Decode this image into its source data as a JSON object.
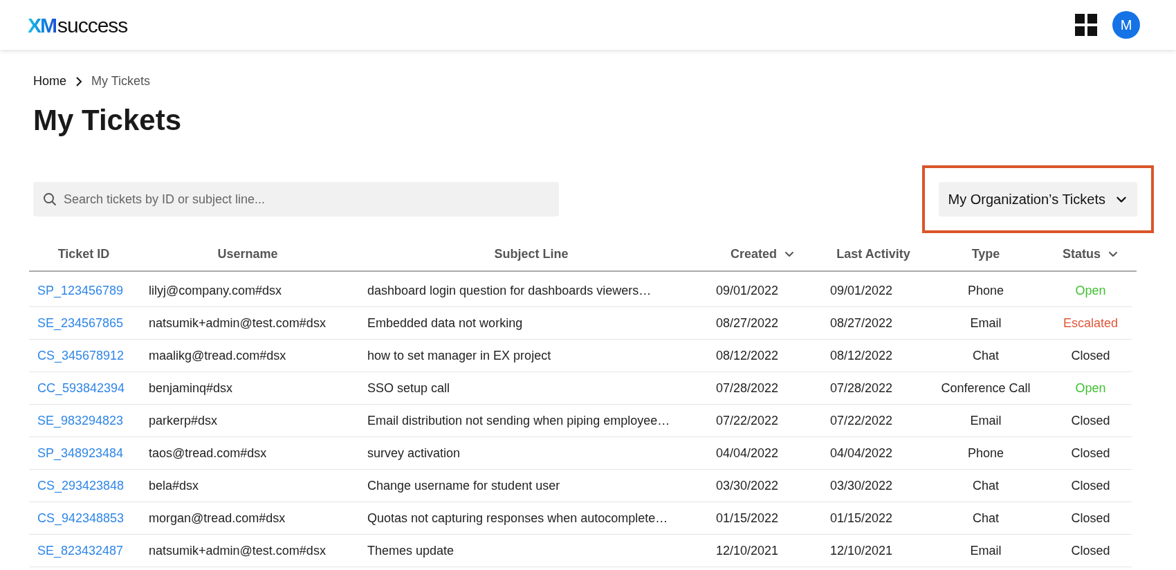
{
  "brand": {
    "mark": "XM",
    "name": "success"
  },
  "user": {
    "initial": "M"
  },
  "breadcrumb": [
    {
      "label": "Home",
      "current": false
    },
    {
      "label": "My Tickets",
      "current": true
    }
  ],
  "title": "My Tickets",
  "search": {
    "placeholder": "Search tickets by ID or subject line..."
  },
  "filter": {
    "label": "My Organization’s Tickets",
    "highlighted": true
  },
  "table": {
    "columns": [
      {
        "label": "Ticket ID",
        "sortable": false
      },
      {
        "label": "Username",
        "sortable": false
      },
      {
        "label": "Subject Line",
        "sortable": false
      },
      {
        "label": "Created",
        "sortable": true
      },
      {
        "label": "Last Activity",
        "sortable": false
      },
      {
        "label": "Type",
        "sortable": false
      },
      {
        "label": "Status",
        "sortable": true
      }
    ],
    "rows": [
      {
        "id": "SP_123456789",
        "username": "lilyj@company.com#dsx",
        "subject": "dashboard login question for dashboards viewers…",
        "created": "09/01/2022",
        "last_activity": "09/01/2022",
        "type": "Phone",
        "status": "Open",
        "color": "#3fbf2f"
      },
      {
        "id": "SE_234567865",
        "username": "natsumik+admin@test.com#dsx",
        "subject": "Embedded data not working",
        "created": "08/27/2022",
        "last_activity": "08/27/2022",
        "type": "Email",
        "status": "Escalated",
        "color": "#e0583a"
      },
      {
        "id": "CS_345678912",
        "username": "maalikg@tread.com#dsx",
        "subject": "how to set manager in EX project",
        "created": "08/12/2022",
        "last_activity": "08/12/2022",
        "type": "Chat",
        "status": "Closed",
        "color": "#222222"
      },
      {
        "id": "CC_593842394",
        "username": "benjaminq#dsx",
        "subject": "SSO setup call",
        "created": "07/28/2022",
        "last_activity": "07/28/2022",
        "type": "Conference Call",
        "status": "Open",
        "color": "#3fbf2f"
      },
      {
        "id": "SE_983294823",
        "username": "parkerp#dsx",
        "subject": "Email distribution not sending when piping employee…",
        "created": "07/22/2022",
        "last_activity": "07/22/2022",
        "type": "Email",
        "status": "Closed",
        "color": "#222222"
      },
      {
        "id": "SP_348923484",
        "username": "taos@tread.com#dsx",
        "subject": "survey activation",
        "created": "04/04/2022",
        "last_activity": "04/04/2022",
        "type": "Phone",
        "status": "Closed",
        "color": "#222222"
      },
      {
        "id": "CS_293423848",
        "username": "bela#dsx",
        "subject": "Change username for student user",
        "created": "03/30/2022",
        "last_activity": "03/30/2022",
        "type": "Chat",
        "status": "Closed",
        "color": "#222222"
      },
      {
        "id": "CS_942348853",
        "username": "morgan@tread.com#dsx",
        "subject": "Quotas not capturing responses when autocomplete…",
        "created": "01/15/2022",
        "last_activity": "01/15/2022",
        "type": "Chat",
        "status": "Closed",
        "color": "#222222"
      },
      {
        "id": "SE_823432487",
        "username": "natsumik+admin@test.com#dsx",
        "subject": "Themes update",
        "created": "12/10/2021",
        "last_activity": "12/10/2021",
        "type": "Email",
        "status": "Closed",
        "color": "#222222"
      }
    ]
  }
}
